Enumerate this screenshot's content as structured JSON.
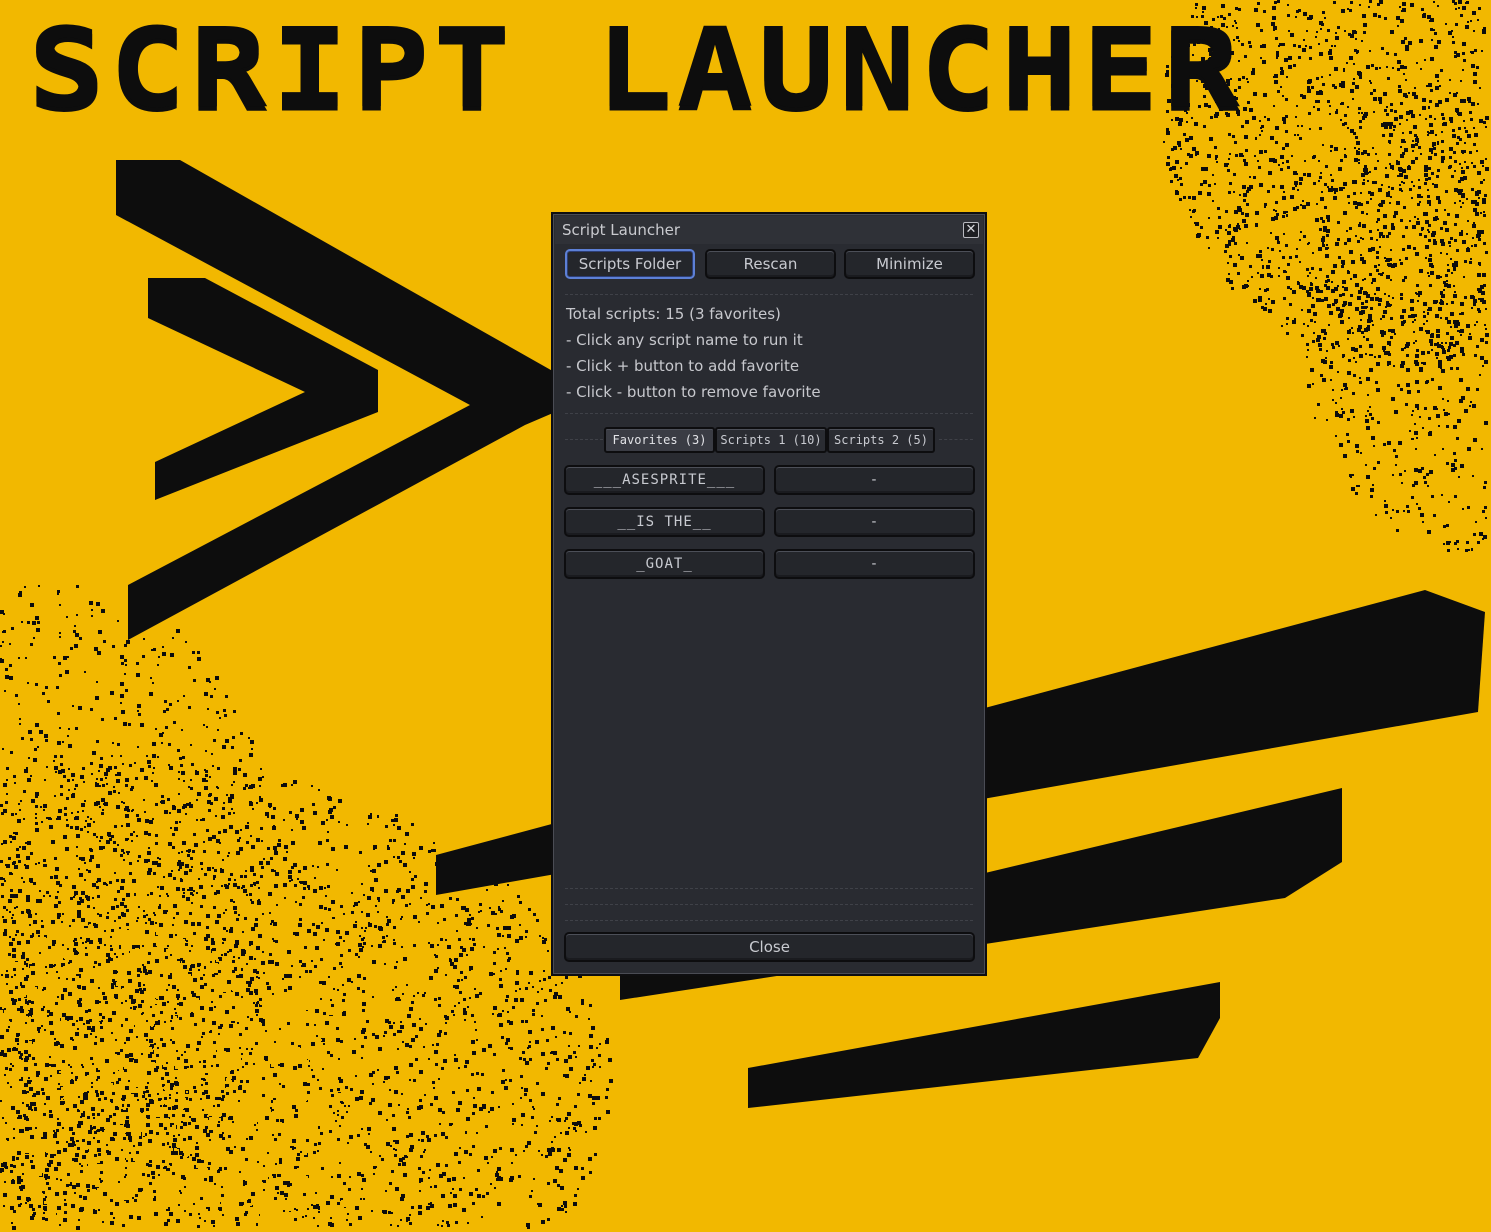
{
  "art": {
    "title": "SCRIPT LAUNCHER"
  },
  "colors": {
    "background": "#f2b800",
    "ink": "#0d0d0d",
    "dialog": "#292b31",
    "focus": "#5d80d6"
  },
  "dialog": {
    "title": "Script Launcher",
    "close_glyph": "✕",
    "toolbar": {
      "scripts_folder": "Scripts Folder",
      "rescan": "Rescan",
      "minimize": "Minimize"
    },
    "info": {
      "total": "Total scripts: 15 (3 favorites)",
      "line1": "- Click any script name to run it",
      "line2": "- Click + button to add favorite",
      "line3": "- Click - button to remove favorite"
    },
    "tabs": [
      {
        "label": "Favorites (3)"
      },
      {
        "label": "Scripts 1 (10)"
      },
      {
        "label": "Scripts 2 (5)"
      }
    ],
    "favorites": [
      {
        "name": "___ASESPRITE___",
        "action": "-"
      },
      {
        "name": "__IS THE__",
        "action": "-"
      },
      {
        "name": "_GOAT_",
        "action": "-"
      }
    ],
    "close_label": "Close"
  }
}
